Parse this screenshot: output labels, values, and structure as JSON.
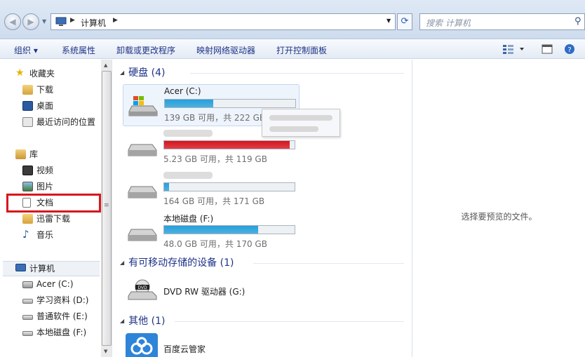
{
  "address_bar": {
    "back_icon": "back-arrow-icon",
    "forward_icon": "forward-arrow-icon",
    "crumb_computer": "计算机",
    "search_placeholder": "搜索 计算机",
    "refresh_icon": "refresh-icon",
    "search_icon": "magnifier-icon"
  },
  "toolbar": {
    "organize": "组织 ▾",
    "system_properties": "系统属性",
    "uninstall": "卸载或更改程序",
    "map_drive": "映射网络驱动器",
    "control_panel": "打开控制面板",
    "view_icon": "view-options-icon",
    "preview_pane_icon": "preview-pane-icon",
    "help_icon": "help-icon"
  },
  "sidebar": {
    "favorites": "收藏夹",
    "favorites_items": [
      "下载",
      "桌面",
      "最近访问的位置"
    ],
    "libraries": "库",
    "library_items": [
      "视频",
      "图片",
      "文档",
      "迅雷下载",
      "音乐"
    ],
    "computer": "计算机",
    "computer_items": [
      "Acer (C:)",
      "学习资料 (D:)",
      "普通软件 (E:)",
      "本地磁盘 (F:)"
    ],
    "highlighted_item": "文档"
  },
  "main": {
    "hard_disks_header": "硬盘 (4)",
    "drives": [
      {
        "name": "Acer (C:)",
        "free": "139 GB 可用，共 222 GB",
        "used_fraction": 0.37,
        "bar_color": "#26a0da",
        "selected": true
      },
      {
        "name": "",
        "free": "5.23 GB 可用，共 119 GB",
        "used_fraction": 0.96,
        "bar_color": "#d8141c",
        "selected": false
      },
      {
        "name": "",
        "free": "164 GB 可用，共 171 GB",
        "used_fraction": 0.04,
        "bar_color": "#26a0da",
        "selected": false
      },
      {
        "name": "本地磁盘 (F:)",
        "free": "48.0 GB 可用，共 170 GB",
        "used_fraction": 0.72,
        "bar_color": "#26a0da",
        "selected": false
      }
    ],
    "removable_header": "有可移动存储的设备 (1)",
    "dvd_name": "DVD RW 驱动器 (G:)",
    "other_header": "其他 (1)",
    "other_item": "百度云管家"
  },
  "preview": {
    "text": "选择要预览的文件。"
  },
  "colors": {
    "highlight_box": "#d9151c",
    "bar_normal": "#26a0da",
    "bar_full": "#d8141c"
  }
}
